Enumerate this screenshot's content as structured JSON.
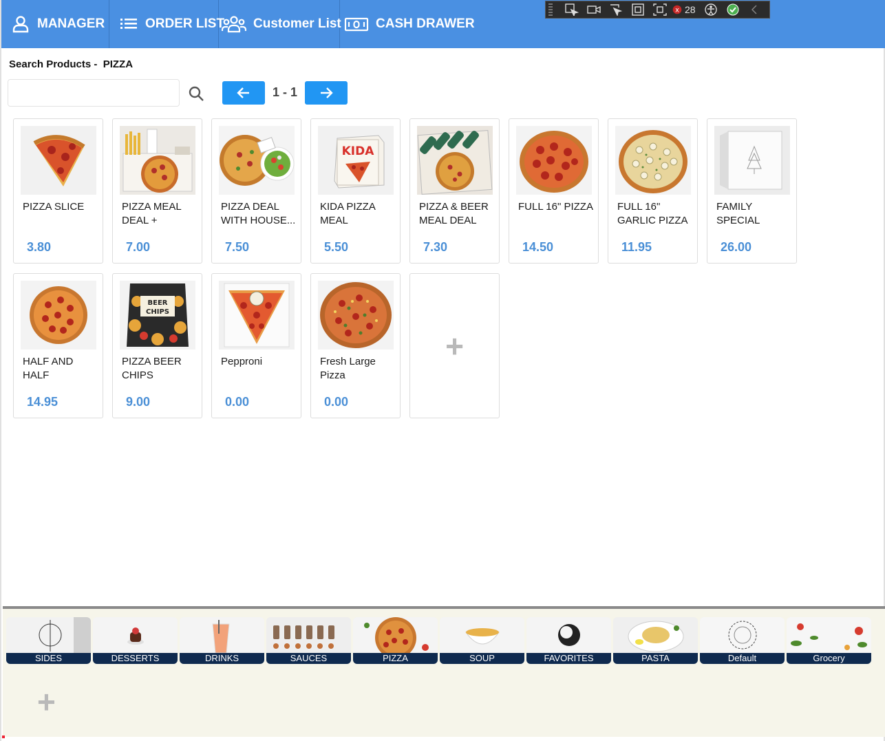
{
  "nav": {
    "manager": "MANAGER",
    "order_list": "ORDER LIST",
    "customer_list": "Customer List",
    "cash_drawer": "CASH DRAWER"
  },
  "devtools": {
    "count": "28",
    "icons": [
      "select-element-icon",
      "video-icon",
      "pointer-icon",
      "frame-icon",
      "inspect-icon",
      "binding-errors-icon",
      "accessibility-icon",
      "check-icon",
      "collapse-icon"
    ]
  },
  "search": {
    "title": "Search Products -  PIZZA",
    "value": "",
    "placeholder": ""
  },
  "pager": {
    "text": "1 - 1"
  },
  "products": [
    {
      "name": "PIZZA SLICE",
      "price": "3.80",
      "image": "pizza-slice"
    },
    {
      "name": "PIZZA MEAL DEAL + FRIES...",
      "price": "7.00",
      "image": "meal-fries"
    },
    {
      "name": "PIZZA DEAL WITH HOUSE...",
      "price": "7.50",
      "image": "pizza-salad"
    },
    {
      "name": "KIDA PIZZA MEAL",
      "price": "5.50",
      "image": "kida-box"
    },
    {
      "name": "PIZZA & BEER MEAL DEAL",
      "price": "7.30",
      "image": "pizza-beer"
    },
    {
      "name": "FULL 16\" PIZZA",
      "price": "14.50",
      "image": "pepperoni-full"
    },
    {
      "name": "FULL 16\" GARLIC PIZZA",
      "price": "11.95",
      "image": "garlic-pizza"
    },
    {
      "name": "FAMILY SPECIAL",
      "price": "26.00",
      "image": "family-box"
    },
    {
      "name": "HALF AND HALF",
      "price": "14.95",
      "image": "half-half"
    },
    {
      "name": "PIZZA BEER CHIPS",
      "price": "9.00",
      "image": "chips-bag"
    },
    {
      "name": "Pepproni",
      "price": "0.00",
      "image": "pepperoni-slice"
    },
    {
      "name": "Fresh Large Pizza",
      "price": "0.00",
      "image": "large-pizza"
    }
  ],
  "add_label": "+",
  "categories": [
    {
      "label": "SIDES"
    },
    {
      "label": "DESSERTS"
    },
    {
      "label": "DRINKS"
    },
    {
      "label": "SAUCES"
    },
    {
      "label": "PIZZA"
    },
    {
      "label": "SOUP"
    },
    {
      "label": "FAVORITES"
    },
    {
      "label": "PASTA"
    },
    {
      "label": "Default"
    },
    {
      "label": "Grocery"
    }
  ],
  "colors": {
    "nav": "#4a90e2",
    "price": "#4a8fd6",
    "pager": "#2196f3",
    "category_label_bg": "#0f2a4f",
    "bottom_bg": "#f6f5ea"
  }
}
